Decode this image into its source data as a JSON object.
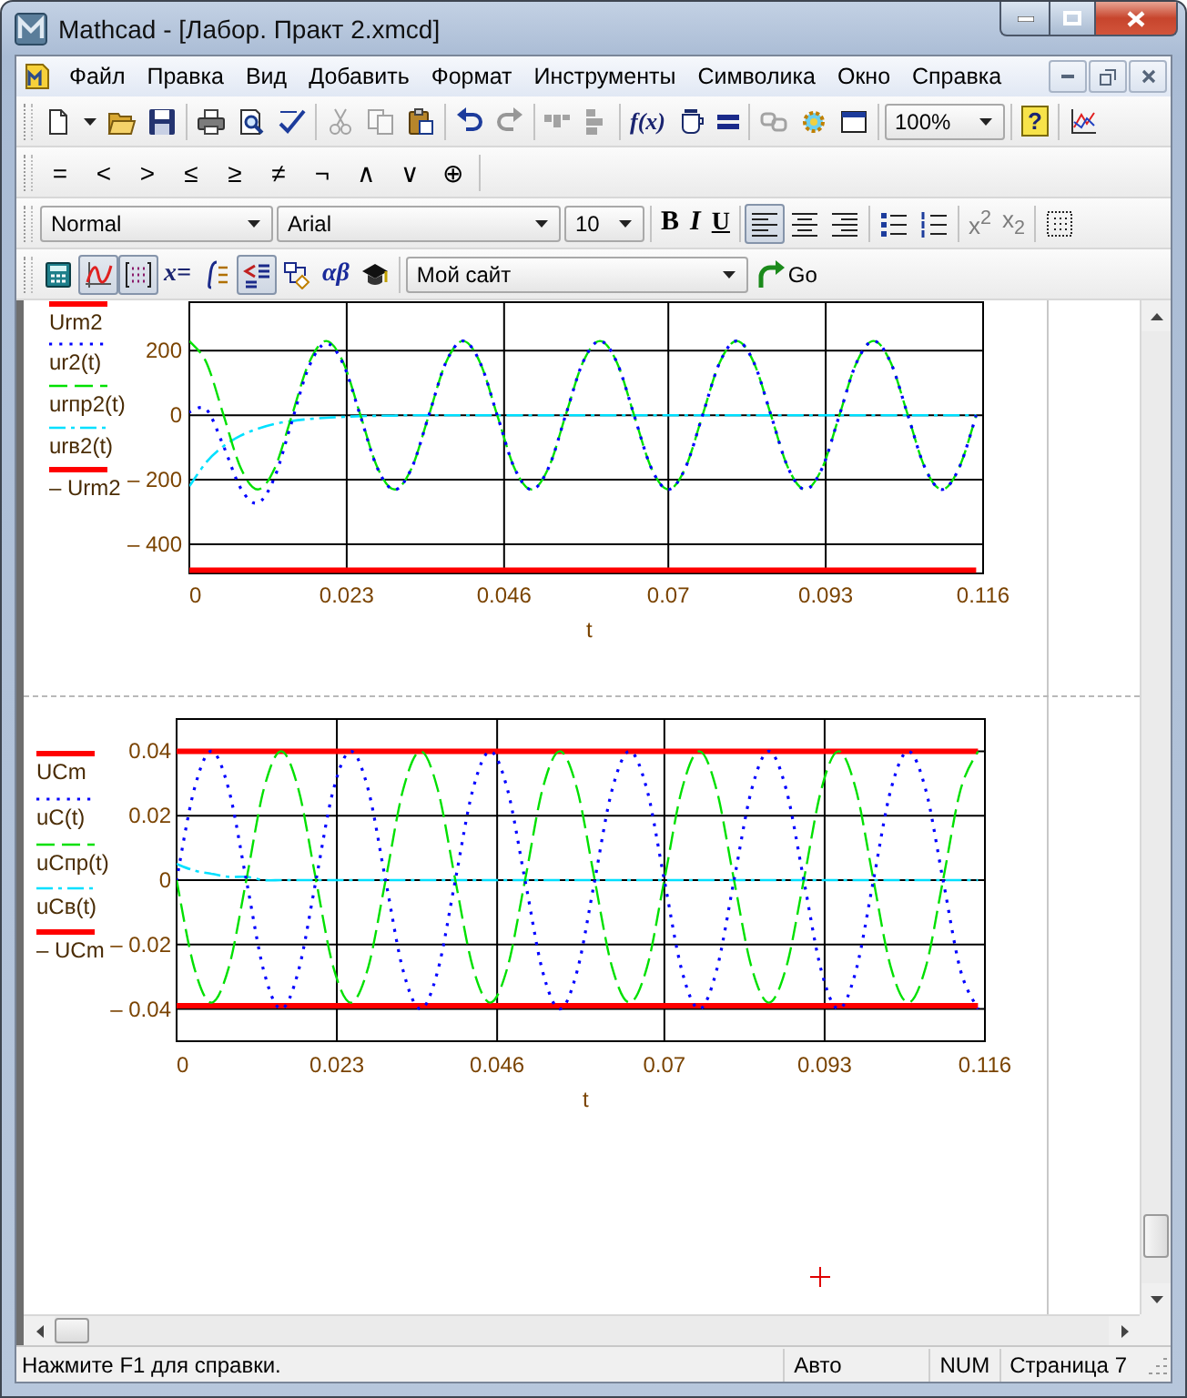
{
  "window": {
    "title": "Mathcad - [Лабор. Практ 2.xmcd]"
  },
  "menu": {
    "items": [
      "Файл",
      "Правка",
      "Вид",
      "Добавить",
      "Формат",
      "Инструменты",
      "Символика",
      "Окно",
      "Справка"
    ]
  },
  "toolbar_standard": {
    "items": [
      {
        "kind": "icon",
        "disabled": false
      },
      {
        "kind": "icon",
        "disabled": false
      },
      {
        "kind": "icon",
        "disabled": false
      },
      {
        "kind": "icon",
        "disabled": false
      },
      {
        "kind": "separator"
      },
      {
        "kind": "icon",
        "disabled": false
      },
      {
        "kind": "icon",
        "disabled": false
      },
      {
        "kind": "icon",
        "disabled": false
      },
      {
        "kind": "separator"
      },
      {
        "kind": "icon",
        "disabled": true
      },
      {
        "kind": "icon",
        "disabled": true
      },
      {
        "kind": "icon",
        "disabled": false
      },
      {
        "kind": "separator"
      },
      {
        "kind": "icon",
        "disabled": false
      },
      {
        "kind": "icon",
        "disabled": true
      },
      {
        "kind": "separator"
      },
      {
        "kind": "icon",
        "disabled": true
      },
      {
        "kind": "icon",
        "disabled": true
      },
      {
        "kind": "separator"
      },
      {
        "kind": "text",
        "label": "f(x)",
        "disabled": false
      },
      {
        "kind": "icon",
        "disabled": false
      },
      {
        "kind": "icon",
        "disabled": false
      },
      {
        "kind": "separator"
      },
      {
        "kind": "icon",
        "disabled": true
      },
      {
        "kind": "icon",
        "disabled": false
      },
      {
        "kind": "icon",
        "disabled": false
      },
      {
        "kind": "separator"
      },
      {
        "kind": "combo",
        "value": "100%"
      },
      {
        "kind": "separator"
      },
      {
        "kind": "text",
        "label": "?",
        "disabled": false
      },
      {
        "kind": "separator"
      },
      {
        "kind": "icon",
        "disabled": false
      }
    ]
  },
  "toolbar_math": {
    "items": [
      {
        "kind": "text",
        "label": "="
      },
      {
        "kind": "text",
        "label": "<"
      },
      {
        "kind": "text",
        "label": ">"
      },
      {
        "kind": "text",
        "label": "≤"
      },
      {
        "kind": "text",
        "label": "≥"
      },
      {
        "kind": "text",
        "label": "≠"
      },
      {
        "kind": "text",
        "label": "¬"
      },
      {
        "kind": "text",
        "label": "∧"
      },
      {
        "kind": "text",
        "label": "∨"
      },
      {
        "kind": "text",
        "label": "⊕"
      },
      {
        "kind": "separator"
      }
    ]
  },
  "toolbar_format": {
    "items": [
      {
        "kind": "combo",
        "value": "Normal"
      },
      {
        "kind": "combo",
        "value": "Arial"
      },
      {
        "kind": "combo",
        "value": "10"
      },
      {
        "kind": "separator"
      },
      {
        "kind": "bold",
        "label": "B",
        "pressed": false
      },
      {
        "kind": "italic",
        "label": "I",
        "pressed": false
      },
      {
        "kind": "underline",
        "label": "U",
        "pressed": false
      },
      {
        "kind": "separator"
      },
      {
        "kind": "icon",
        "pressed": true
      },
      {
        "kind": "icon",
        "pressed": false
      },
      {
        "kind": "icon",
        "pressed": false
      },
      {
        "kind": "separator"
      },
      {
        "kind": "icon",
        "pressed": false
      },
      {
        "kind": "icon",
        "pressed": false
      },
      {
        "kind": "separator"
      },
      {
        "kind": "text",
        "label": "x$^{2}$",
        "disabled": true
      },
      {
        "kind": "text",
        "label": "x$_{2}$",
        "disabled": true
      },
      {
        "kind": "separator"
      },
      {
        "kind": "icon",
        "pressed": false
      }
    ]
  },
  "toolbar_resources": {
    "items": [
      {
        "kind": "icon",
        "pressed": false
      },
      {
        "kind": "icon",
        "pressed": true
      },
      {
        "kind": "icon",
        "pressed": true
      },
      {
        "kind": "text",
        "label": "x=",
        "pressed": false
      },
      {
        "kind": "icon",
        "pressed": false
      },
      {
        "kind": "icon",
        "pressed": true
      },
      {
        "kind": "icon",
        "pressed": false
      },
      {
        "kind": "text",
        "label": "αβ",
        "pressed": false
      },
      {
        "kind": "icon",
        "pressed": false
      },
      {
        "kind": "separator"
      },
      {
        "kind": "combo",
        "value": "Мой сайт"
      },
      {
        "kind": "go",
        "label": "Go"
      }
    ]
  },
  "document": {
    "plots": [
      {
        "clipped_label": "Urm2",
        "chart_data": {
          "type": "line",
          "grid": true,
          "legend": "left",
          "xlabel": "t",
          "xlim": [
            0,
            0.116
          ],
          "ylim": [
            -490,
            350
          ],
          "xticks": [
            0,
            0.023,
            0.046,
            0.07,
            0.093,
            0.116
          ],
          "yticks": [
            {
              "value": 200,
              "label": "200"
            },
            {
              "value": 0,
              "label": "0"
            },
            {
              "value": -200,
              "label": "– 200"
            },
            {
              "value": -400,
              "label": "– 400"
            }
          ],
          "x": [
            0,
            0.0025,
            0.005,
            0.0075,
            0.01,
            0.0125,
            0.015,
            0.0175,
            0.02,
            0.0225,
            0.025,
            0.0275,
            0.03,
            0.0325,
            0.035,
            0.0375,
            0.04,
            0.0425,
            0.045,
            0.0475,
            0.05,
            0.0525,
            0.055,
            0.0575,
            0.06,
            0.0625,
            0.065,
            0.0675,
            0.07,
            0.0725,
            0.075,
            0.0775,
            0.08,
            0.0825,
            0.085,
            0.0875,
            0.09,
            0.0925,
            0.095,
            0.0975,
            0.1,
            0.1025,
            0.105,
            0.1075,
            0.11,
            0.1125,
            0.115
          ],
          "series": [
            {
              "name": "ur2(t)",
              "color": "#0000ff",
              "line_style": "dotted",
              "values": [
                10,
                18,
                -96,
                -226,
                -272,
                -190,
                -18,
                151,
                222,
                158,
                -3,
                -165,
                -231,
                -163,
                0,
                163,
                230,
                163,
                0,
                -163,
                -230,
                -163,
                0,
                163,
                230,
                163,
                0,
                -163,
                -230,
                -163,
                0,
                163,
                230,
                163,
                0,
                -163,
                -230,
                -163,
                0,
                163,
                230,
                163,
                0,
                -163,
                -230,
                -163,
                0
              ]
            },
            {
              "name": "urпр2(t)",
              "color": "#00e000",
              "line_style": "dashed",
              "values": [
                230,
                163,
                0,
                -163,
                -230,
                -163,
                0,
                163,
                230,
                163,
                0,
                -163,
                -230,
                -163,
                0,
                163,
                230,
                163,
                0,
                -163,
                -230,
                -163,
                0,
                163,
                230,
                163,
                0,
                -163,
                -230,
                -163,
                0,
                163,
                230,
                163,
                0,
                -163,
                -230,
                -163,
                0,
                163,
                230,
                163,
                0,
                -163,
                -230,
                -163,
                0
              ]
            },
            {
              "name": "urв2(t)",
              "color": "#00e0ff",
              "line_style": "dashdot",
              "values": [
                -220,
                -145,
                -96,
                -63,
                -42,
                -27,
                -18,
                -12,
                -8,
                -5,
                -3,
                -2,
                -1,
                0,
                0,
                0,
                0,
                0,
                0,
                0,
                0,
                0,
                0,
                0,
                0,
                0,
                0,
                0,
                0,
                0,
                0,
                0,
                0,
                0,
                0,
                0,
                0,
                0,
                0,
                0,
                0,
                0,
                0,
                0,
                0,
                0,
                0
              ]
            },
            {
              "name": "– Urm2",
              "color": "#ff0000",
              "line_style": "solid",
              "values": [
                -480,
                -480,
                -480,
                -480,
                -480,
                -480,
                -480,
                -480,
                -480,
                -480,
                -480,
                -480,
                -480,
                -480,
                -480,
                -480,
                -480,
                -480,
                -480,
                -480,
                -480,
                -480,
                -480,
                -480,
                -480,
                -480,
                -480,
                -480,
                -480,
                -480,
                -480,
                -480,
                -480,
                -480,
                -480,
                -480,
                -480,
                -480,
                -480,
                -480,
                -480,
                -480,
                -480,
                -480,
                -480,
                -480,
                -480
              ]
            }
          ]
        }
      },
      {
        "chart_data": {
          "type": "line",
          "grid": true,
          "legend": "left",
          "xlabel": "t",
          "xlim": [
            0,
            0.116
          ],
          "ylim": [
            -0.05,
            0.05
          ],
          "xticks": [
            0,
            0.023,
            0.046,
            0.07,
            0.093,
            0.116
          ],
          "yticks": [
            {
              "value": 0.04,
              "label": "0.04"
            },
            {
              "value": 0.02,
              "label": "0.02"
            },
            {
              "value": 0,
              "label": "0"
            },
            {
              "value": -0.02,
              "label": "– 0.02"
            },
            {
              "value": -0.04,
              "label": "– 0.04"
            }
          ],
          "x": [
            0,
            0.0025,
            0.005,
            0.0075,
            0.01,
            0.0125,
            0.015,
            0.0175,
            0.02,
            0.0225,
            0.025,
            0.0275,
            0.03,
            0.0325,
            0.035,
            0.0375,
            0.04,
            0.0425,
            0.045,
            0.0475,
            0.05,
            0.0525,
            0.055,
            0.0575,
            0.06,
            0.0625,
            0.065,
            0.0675,
            0.07,
            0.0725,
            0.075,
            0.0775,
            0.08,
            0.0825,
            0.085,
            0.0875,
            0.09,
            0.0925,
            0.095,
            0.0975,
            0.1,
            0.1025,
            0.105,
            0.1075,
            0.11,
            0.1125,
            0.115
          ],
          "series": [
            {
              "name": "UCm",
              "color": "#ff0000",
              "line_style": "solid",
              "values": [
                0.04,
                0.04,
                0.04,
                0.04,
                0.04,
                0.04,
                0.04,
                0.04,
                0.04,
                0.04,
                0.04,
                0.04,
                0.04,
                0.04,
                0.04,
                0.04,
                0.04,
                0.04,
                0.04,
                0.04,
                0.04,
                0.04,
                0.04,
                0.04,
                0.04,
                0.04,
                0.04,
                0.04,
                0.04,
                0.04,
                0.04,
                0.04,
                0.04,
                0.04,
                0.04,
                0.04,
                0.04,
                0.04,
                0.04,
                0.04,
                0.04,
                0.04,
                0.04,
                0.04,
                0.04,
                0.04,
                0.04
              ]
            },
            {
              "name": "uC(t)",
              "color": "#0000ff",
              "line_style": "dotted",
              "values": [
                0,
                0.028,
                0.04,
                0.028,
                0,
                -0.028,
                -0.04,
                -0.028,
                0,
                0.028,
                0.04,
                0.028,
                0,
                -0.028,
                -0.04,
                -0.028,
                0,
                0.028,
                0.04,
                0.028,
                0,
                -0.028,
                -0.04,
                -0.028,
                0,
                0.028,
                0.04,
                0.028,
                0,
                -0.028,
                -0.04,
                -0.028,
                0,
                0.028,
                0.04,
                0.028,
                0,
                -0.028,
                -0.04,
                -0.028,
                0,
                0.028,
                0.04,
                0.028,
                0,
                -0.028,
                -0.04
              ]
            },
            {
              "name": "uCпр(t)",
              "color": "#00e000",
              "line_style": "dashed",
              "values": [
                0,
                -0.027,
                -0.038,
                -0.027,
                0,
                0.028,
                0.04,
                0.028,
                0,
                -0.027,
                -0.038,
                -0.027,
                0,
                0.028,
                0.04,
                0.028,
                0,
                -0.027,
                -0.038,
                -0.027,
                0,
                0.028,
                0.04,
                0.028,
                0,
                -0.027,
                -0.038,
                -0.027,
                0,
                0.028,
                0.04,
                0.028,
                0,
                -0.027,
                -0.038,
                -0.027,
                0,
                0.028,
                0.04,
                0.028,
                0,
                -0.027,
                -0.038,
                -0.027,
                0,
                0.028,
                0.04
              ]
            },
            {
              "name": "uCв(t)",
              "color": "#00e0ff",
              "line_style": "dashdot",
              "values": [
                0.005,
                0.003,
                0.002,
                0.001,
                0.001,
                0,
                0,
                0,
                0,
                0,
                0,
                0,
                0,
                0,
                0,
                0,
                0,
                0,
                0,
                0,
                0,
                0,
                0,
                0,
                0,
                0,
                0,
                0,
                0,
                0,
                0,
                0,
                0,
                0,
                0,
                0,
                0,
                0,
                0,
                0,
                0,
                0,
                0,
                0,
                0,
                0,
                0
              ]
            },
            {
              "name": "– UCm",
              "color": "#ff0000",
              "line_style": "solid",
              "values": [
                -0.039,
                -0.039,
                -0.039,
                -0.039,
                -0.039,
                -0.039,
                -0.039,
                -0.039,
                -0.039,
                -0.039,
                -0.039,
                -0.039,
                -0.039,
                -0.039,
                -0.039,
                -0.039,
                -0.039,
                -0.039,
                -0.039,
                -0.039,
                -0.039,
                -0.039,
                -0.039,
                -0.039,
                -0.039,
                -0.039,
                -0.039,
                -0.039,
                -0.039,
                -0.039,
                -0.039,
                -0.039,
                -0.039,
                -0.039,
                -0.039,
                -0.039,
                -0.039,
                -0.039,
                -0.039,
                -0.039,
                -0.039,
                -0.039,
                -0.039,
                -0.039,
                -0.039,
                -0.039,
                -0.039
              ]
            }
          ]
        }
      }
    ]
  },
  "status_bar": {
    "message": "Нажмите F1 для справки.",
    "panels": [
      "Авто",
      "NUM",
      "Страница 7"
    ]
  }
}
